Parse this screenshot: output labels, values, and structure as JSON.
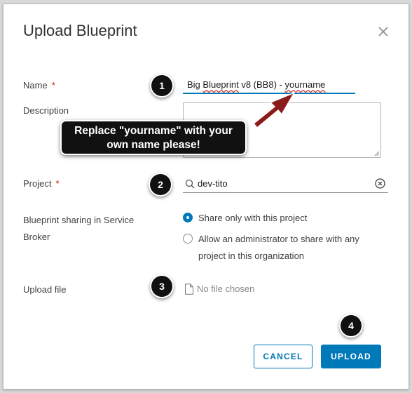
{
  "dialog": {
    "title": "Upload Blueprint",
    "close_icon": "close-icon"
  },
  "form": {
    "name_label": "Name",
    "required_mark": "*",
    "name_value_part1": "Big ",
    "name_value_part2": "Blueprint",
    "name_value_part3": " v8 (BB8) - ",
    "name_value_part4": "yourname",
    "description_label": "Description",
    "description_value": "",
    "project_label": "Project",
    "project_value": "dev-tito",
    "sharing_label_line1": "Blueprint sharing in Service",
    "sharing_label_line2": "Broker",
    "sharing_options": [
      {
        "label": "Share only with this project",
        "selected": true
      },
      {
        "label_line1": "Allow an administrator to share with any",
        "label_line2": "project in this organization",
        "selected": false
      }
    ],
    "upload_file_label": "Upload file",
    "file_status": "No file chosen"
  },
  "buttons": {
    "cancel": "CANCEL",
    "upload": "UPLOAD"
  },
  "annotations": {
    "steps": [
      "1",
      "2",
      "3",
      "4"
    ],
    "callout_line1": "Replace \"yourname\" with your",
    "callout_line2": "own name please!"
  },
  "colors": {
    "accent": "#0079b8",
    "required": "#c92100",
    "arrow": "#8b1a1a"
  }
}
